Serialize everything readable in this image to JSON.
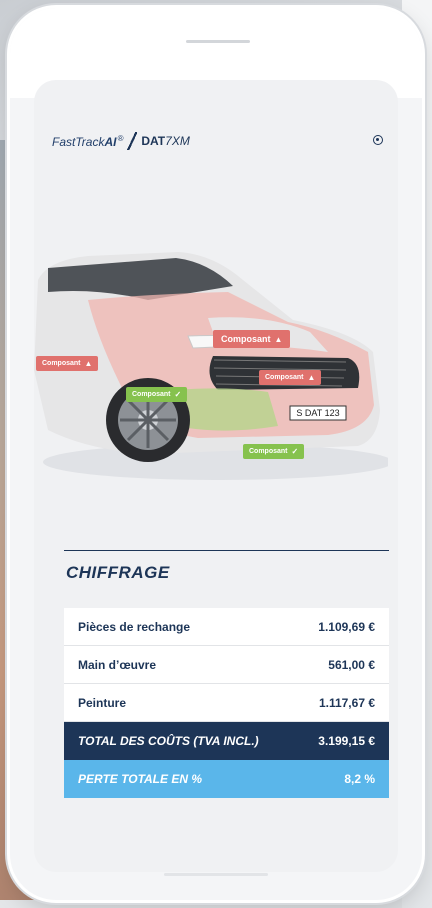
{
  "header": {
    "brand_fasttrack": "FastTrack",
    "brand_ai": "AI",
    "brand_reg": "®",
    "brand_dat": "DAT",
    "brand_dat_suffix": "7XM"
  },
  "damage_tags": [
    {
      "label": "Composant",
      "status": "warning",
      "color": "#e0716d"
    },
    {
      "label": "Composant",
      "status": "warning",
      "color": "#e0716d"
    },
    {
      "label": "Composant",
      "status": "warning",
      "color": "#e0716d"
    },
    {
      "label": "Composant",
      "status": "ok",
      "color": "#86c24e"
    },
    {
      "label": "Composant",
      "status": "ok",
      "color": "#86c24e"
    }
  ],
  "car": {
    "plate": "S DAT 123"
  },
  "section": {
    "title": "CHIFFRAGE"
  },
  "costs": {
    "rows": [
      {
        "label": "Pièces de rechange",
        "value": "1.109,69 €"
      },
      {
        "label": "Main d’œuvre",
        "value": "561,00 €"
      },
      {
        "label": "Peinture",
        "value": "1.117,67 €"
      }
    ],
    "total": {
      "label": "TOTAL DES COÛTS (TVA INCL.)",
      "value": "3.199,15 €"
    },
    "loss": {
      "label": "PERTE TOTALE EN %",
      "value": "8,2 %"
    }
  },
  "colors": {
    "navy": "#1d3557",
    "light_blue": "#5ab6ea",
    "damage_red": "#e0716d",
    "ok_green": "#86c24e"
  }
}
